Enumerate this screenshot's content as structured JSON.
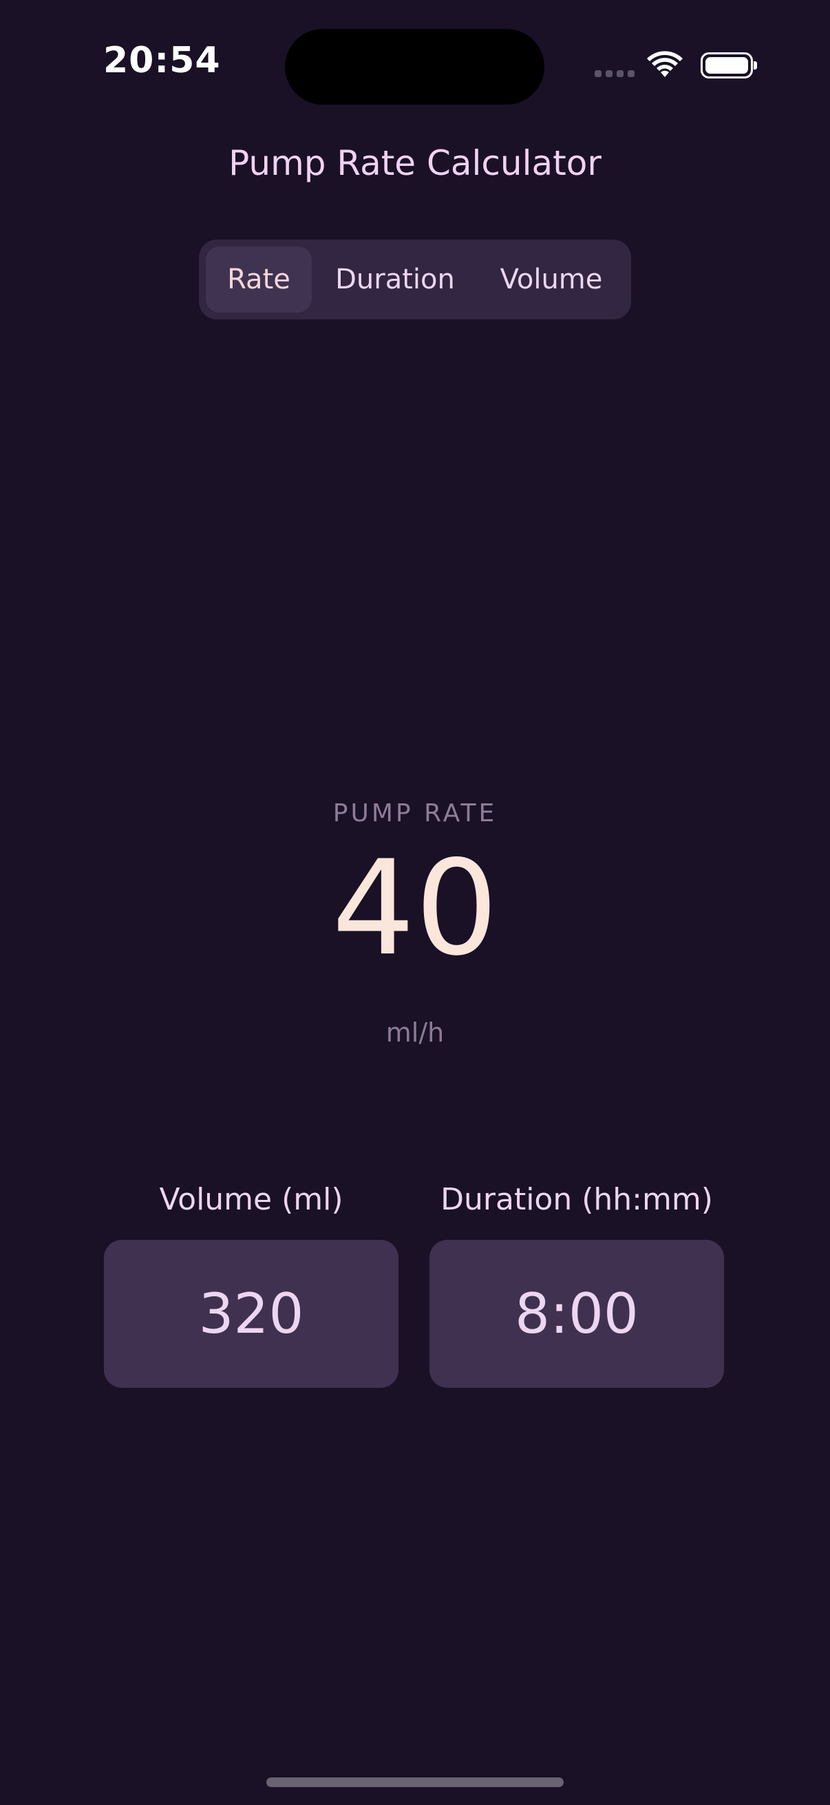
{
  "status_bar": {
    "time": "20:54"
  },
  "header": {
    "title": "Pump Rate Calculator"
  },
  "tabs": [
    {
      "label": "Rate",
      "active": true
    },
    {
      "label": "Duration",
      "active": false
    },
    {
      "label": "Volume",
      "active": false
    }
  ],
  "result": {
    "label": "PUMP RATE",
    "value": "40",
    "unit": "ml/h"
  },
  "inputs": {
    "volume": {
      "label": "Volume (ml)",
      "value": "320"
    },
    "duration": {
      "label": "Duration (hh:mm)",
      "value": "8:00"
    }
  },
  "colors": {
    "background": "#1a1126",
    "segmented_bg": "#332642",
    "segment_active": "#403352",
    "input_bg": "#403150",
    "accent_text": "#fbe6dc"
  },
  "icons": {
    "signal": "signal-dots-icon",
    "wifi": "wifi-icon",
    "battery": "battery-icon"
  }
}
